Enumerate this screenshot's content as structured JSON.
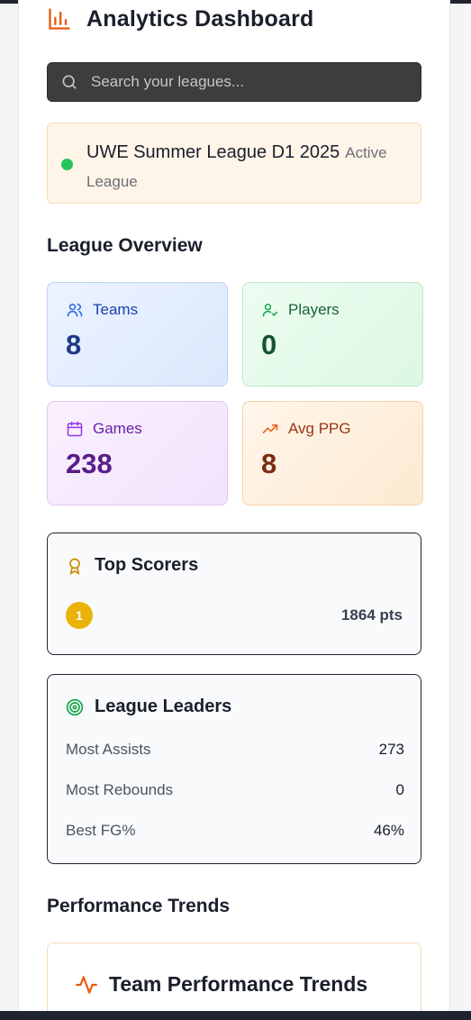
{
  "header": {
    "title": "Analytics Dashboard",
    "icon": "bar-chart-icon"
  },
  "search": {
    "placeholder": "Search your leagues...",
    "value": ""
  },
  "league": {
    "name": "UWE Summer League D1 2025",
    "status": "Active League",
    "status_color": "#22c55e"
  },
  "overview": {
    "title": "League Overview",
    "stats": [
      {
        "label": "Teams",
        "value": "8",
        "icon": "users-icon"
      },
      {
        "label": "Players",
        "value": "0",
        "icon": "user-check-icon"
      },
      {
        "label": "Games",
        "value": "238",
        "icon": "calendar-icon"
      },
      {
        "label": "Avg PPG",
        "value": "8",
        "icon": "trending-up-icon"
      }
    ]
  },
  "top_scorers": {
    "title": "Top Scorers",
    "icon": "award-icon",
    "entries": [
      {
        "rank": "1",
        "points": "1864 pts"
      }
    ]
  },
  "leaders": {
    "title": "League Leaders",
    "icon": "target-icon",
    "rows": [
      {
        "label": "Most Assists",
        "value": "273"
      },
      {
        "label": "Most Rebounds",
        "value": "0"
      },
      {
        "label": "Best FG%",
        "value": "46%"
      }
    ]
  },
  "trends": {
    "title": "Performance Trends",
    "card_title": "Team Performance Trends",
    "icon": "activity-icon"
  },
  "colors": {
    "accent": "#ea580c",
    "gold": "#eab308",
    "green": "#22c55e"
  }
}
